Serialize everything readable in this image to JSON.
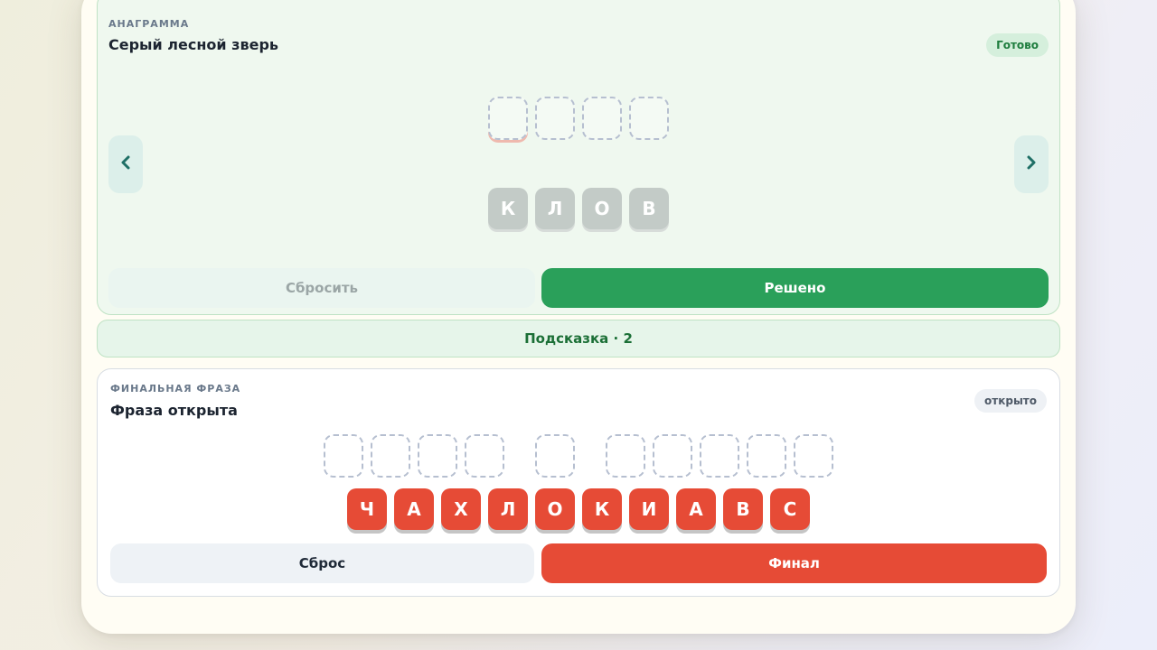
{
  "anagram": {
    "kicker": "АНАГРАММА",
    "title": "Серый лесной зверь",
    "badge": "Готово",
    "letters": [
      "К",
      "Л",
      "О",
      "В"
    ],
    "reset_label": "Сбросить",
    "solved_label": "Решено"
  },
  "hint": {
    "label": "Подсказка · 2"
  },
  "final": {
    "kicker": "ФИНАЛЬНАЯ ФРАЗА",
    "title": "Фраза открыта",
    "badge": "открыто",
    "letters": [
      "Ч",
      "А",
      "Х",
      "Л",
      "О",
      "К",
      "И",
      "А",
      "В",
      "С"
    ],
    "reset_label": "Сброс",
    "final_label": "Финал"
  },
  "colors": {
    "accent_green": "#2aa05a",
    "accent_red": "#e64b36"
  },
  "icons": {
    "prev": "chevron-left-icon",
    "next": "chevron-right-icon"
  }
}
